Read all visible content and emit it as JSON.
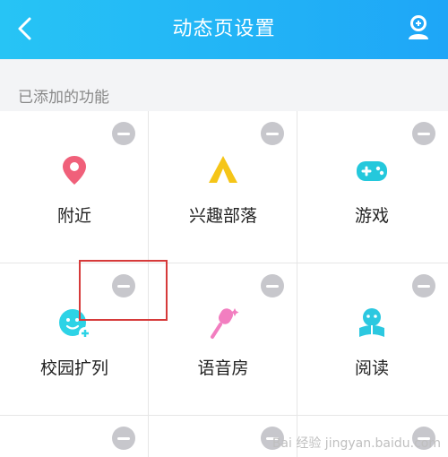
{
  "header": {
    "title": "动态页设置",
    "back_icon": "chevron-left-icon",
    "right_icon": "user-add-icon"
  },
  "section": {
    "label": "已添加的功能"
  },
  "items": [
    {
      "label": "附近",
      "icon": "location-pin-icon",
      "color": "#f0607a"
    },
    {
      "label": "兴趣部落",
      "icon": "tent-icon",
      "color": "#f5c518"
    },
    {
      "label": "游戏",
      "icon": "gamepad-icon",
      "color": "#24c8dc"
    },
    {
      "label": "校园扩列",
      "icon": "smile-add-icon",
      "color": "#2dd3e6"
    },
    {
      "label": "语音房",
      "icon": "microphone-icon",
      "color": "#f27ec0"
    },
    {
      "label": "阅读",
      "icon": "reading-icon",
      "color": "#2cc8e0"
    }
  ],
  "watermark": "Bai 经验 jingyan.baidu.com"
}
